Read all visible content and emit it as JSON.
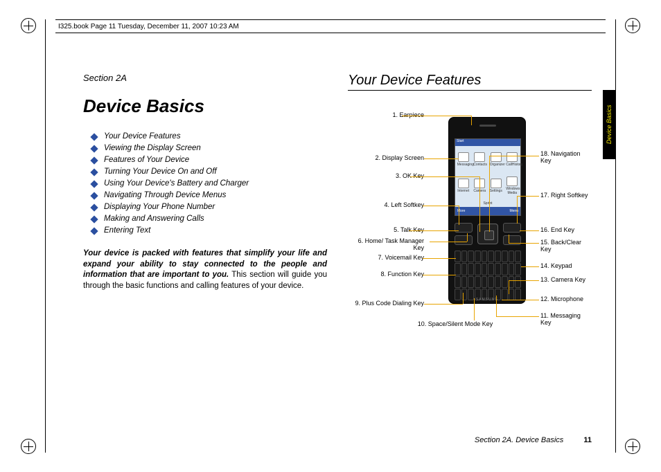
{
  "header": {
    "crop_text": "I325.book  Page 11  Tuesday, December 11, 2007  10:23 AM"
  },
  "sidetab": "Device Basics",
  "left": {
    "section": "Section 2A",
    "title": "Device Basics",
    "toc": [
      "Your Device Features",
      "Viewing the Display Screen",
      "Features of Your Device",
      "Turning Your Device On and Off",
      "Using Your Device's Battery and Charger",
      "Navigating Through Device Menus",
      "Displaying Your Phone Number",
      "Making and Answering Calls",
      "Entering Text"
    ],
    "intro_bold": "Your device is packed with features that simplify your life and expand your ability to stay connected to the people and information that are important to you.",
    "intro_rest": " This section will guide you through the basic functions and calling features of your device."
  },
  "right": {
    "title": "Your Device Features",
    "callouts_left": {
      "c1": "1. Earpiece",
      "c2": "2. Display Screen",
      "c3": "3. OK Key",
      "c4": "4. Left Softkey",
      "c5": "5. Talk Key",
      "c6": "6. Home/ Task Manager Key",
      "c7": "7. Voicemail Key",
      "c8": "8. Function Key",
      "c9": "9. Plus Code Dialing Key",
      "c10": "10. Space/Silent Mode Key"
    },
    "callouts_right": {
      "c18": "18. Navigation Key",
      "c17": "17. Right Softkey",
      "c16": "16. End Key",
      "c15": "15. Back/Clear Key",
      "c14": "14. Keypad",
      "c13": "13. Camera Key",
      "c12": "12. Microphone",
      "c11": "11. Messaging Key"
    },
    "screen": {
      "status": "Start",
      "icons_r1": [
        "Messaging",
        "Contacts",
        "Organizer",
        "CallHistory"
      ],
      "icons_r2": [
        "Internet",
        "Camera",
        "Settings",
        "Windows Media"
      ],
      "soft_left": "More",
      "soft_right": "Menu",
      "carrier": "Sprint",
      "brand": "SAMSUNG"
    }
  },
  "footer": {
    "section": "Section 2A. Device Basics",
    "page": "11"
  }
}
